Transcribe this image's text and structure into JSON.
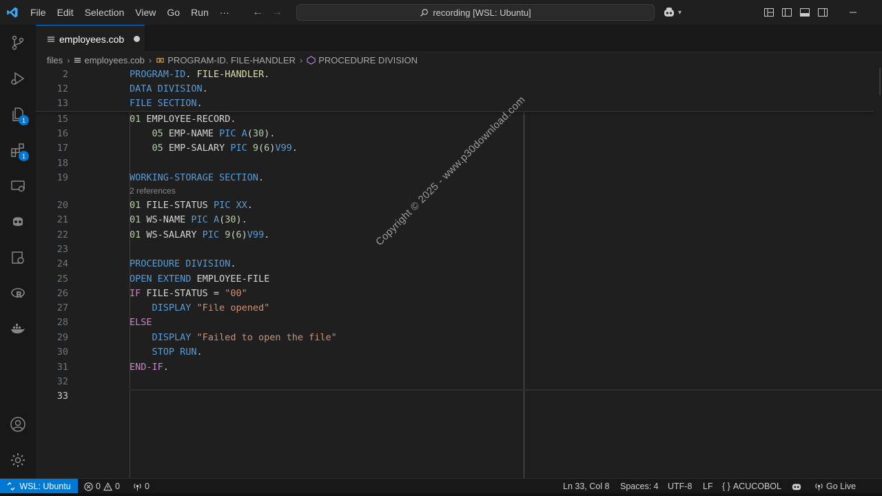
{
  "menu": [
    "File",
    "Edit",
    "Selection",
    "View",
    "Go",
    "Run",
    "···"
  ],
  "command_center": "recording [WSL: Ubuntu]",
  "tab": {
    "label": "employees.cob"
  },
  "breadcrumb": [
    "files",
    "employees.cob",
    "PROGRAM-ID. FILE-HANDLER",
    "PROCEDURE DIVISION"
  ],
  "activity_badges": {
    "explorer": "1",
    "extensions": "1"
  },
  "editor": {
    "sticky": [
      {
        "ln": "2",
        "tokens": [
          [
            "kw",
            "PROGRAM-ID"
          ],
          [
            "id",
            ". "
          ],
          [
            "fn",
            "FILE-HANDLER"
          ],
          [
            "id",
            "."
          ]
        ]
      },
      {
        "ln": "12",
        "tokens": [
          [
            "kw",
            "DATA DIVISION"
          ],
          [
            "id",
            "."
          ]
        ]
      },
      {
        "ln": "13",
        "tokens": [
          [
            "kw",
            "FILE SECTION"
          ],
          [
            "id",
            "."
          ]
        ]
      }
    ],
    "lines": [
      {
        "ln": "15",
        "tokens": [
          [
            "num",
            "01 "
          ],
          [
            "id",
            "EMPLOYEE-RECORD."
          ]
        ]
      },
      {
        "ln": "16",
        "tokens": [
          [
            "id",
            "    "
          ],
          [
            "num",
            "05 "
          ],
          [
            "id",
            "EMP-NAME "
          ],
          [
            "pic",
            "PIC "
          ],
          [
            "kw",
            "A"
          ],
          [
            "id",
            "("
          ],
          [
            "num",
            "30"
          ],
          [
            "id",
            ")."
          ]
        ]
      },
      {
        "ln": "17",
        "tokens": [
          [
            "id",
            "    "
          ],
          [
            "num",
            "05 "
          ],
          [
            "id",
            "EMP-SALARY "
          ],
          [
            "pic",
            "PIC "
          ],
          [
            "num",
            "9"
          ],
          [
            "id",
            "("
          ],
          [
            "num",
            "6"
          ],
          [
            "id",
            ")"
          ],
          [
            "kw",
            "V99"
          ],
          [
            "id",
            "."
          ]
        ]
      },
      {
        "ln": "18",
        "tokens": []
      },
      {
        "ln": "19",
        "tokens": [
          [
            "kw",
            "WORKING-STORAGE SECTION"
          ],
          [
            "id",
            "."
          ]
        ]
      },
      {
        "ln": "20",
        "tokens": [
          [
            "num",
            "01 "
          ],
          [
            "id",
            "FILE-STATUS "
          ],
          [
            "pic",
            "PIC "
          ],
          [
            "kw",
            "XX"
          ],
          [
            "id",
            "."
          ]
        ]
      },
      {
        "ln": "21",
        "tokens": [
          [
            "num",
            "01 "
          ],
          [
            "id",
            "WS-NAME "
          ],
          [
            "pic",
            "PIC "
          ],
          [
            "kw",
            "A"
          ],
          [
            "id",
            "("
          ],
          [
            "num",
            "30"
          ],
          [
            "id",
            ")."
          ]
        ]
      },
      {
        "ln": "22",
        "tokens": [
          [
            "num",
            "01 "
          ],
          [
            "id",
            "WS-SALARY "
          ],
          [
            "pic",
            "PIC "
          ],
          [
            "num",
            "9"
          ],
          [
            "id",
            "("
          ],
          [
            "num",
            "6"
          ],
          [
            "id",
            ")"
          ],
          [
            "kw",
            "V99"
          ],
          [
            "id",
            "."
          ]
        ]
      },
      {
        "ln": "23",
        "tokens": []
      },
      {
        "ln": "24",
        "tokens": [
          [
            "kw",
            "PROCEDURE DIVISION"
          ],
          [
            "id",
            "."
          ]
        ]
      },
      {
        "ln": "25",
        "tokens": [
          [
            "kw",
            "OPEN EXTEND "
          ],
          [
            "id",
            "EMPLOYEE-FILE"
          ]
        ]
      },
      {
        "ln": "26",
        "tokens": [
          [
            "ctl",
            "IF "
          ],
          [
            "id",
            "FILE-STATUS = "
          ],
          [
            "str",
            "\"00\""
          ]
        ]
      },
      {
        "ln": "27",
        "tokens": [
          [
            "id",
            "    "
          ],
          [
            "kw",
            "DISPLAY "
          ],
          [
            "str",
            "\"File opened\""
          ]
        ]
      },
      {
        "ln": "28",
        "tokens": [
          [
            "ctl",
            "ELSE"
          ]
        ]
      },
      {
        "ln": "29",
        "tokens": [
          [
            "id",
            "    "
          ],
          [
            "kw",
            "DISPLAY "
          ],
          [
            "str",
            "\"Failed to open the file\""
          ]
        ]
      },
      {
        "ln": "30",
        "tokens": [
          [
            "id",
            "    "
          ],
          [
            "kw",
            "STOP RUN"
          ],
          [
            "id",
            "."
          ]
        ]
      },
      {
        "ln": "31",
        "tokens": [
          [
            "ctl",
            "END-IF"
          ],
          [
            "id",
            "."
          ]
        ]
      },
      {
        "ln": "32",
        "tokens": []
      },
      {
        "ln": "33",
        "tokens": []
      }
    ],
    "codelens": "2 references",
    "watermark": "Copyright © 2025 - www.p30download.com"
  },
  "status": {
    "remote": "WSL: Ubuntu",
    "errors": "0",
    "warnings": "0",
    "ports": "0",
    "position": "Ln 33, Col 8",
    "spaces": "Spaces: 4",
    "encoding": "UTF-8",
    "eol": "LF",
    "language": "ACUCOBOL",
    "go_live": "Go Live"
  },
  "colors": {
    "accent": "#0078d4",
    "editor_bg": "#1f1f1f"
  }
}
